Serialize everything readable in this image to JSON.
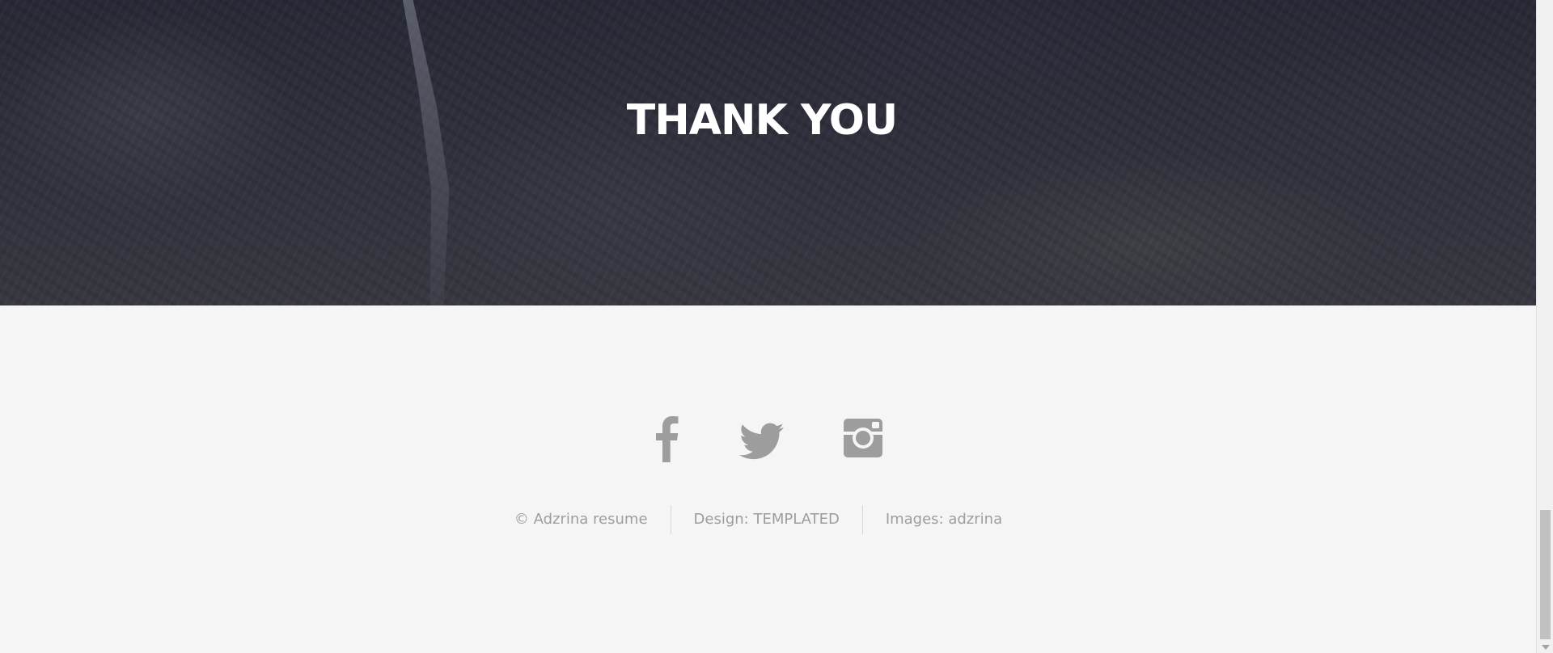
{
  "banner": {
    "title": "THANK YOU"
  },
  "footer": {
    "social": [
      {
        "name": "facebook",
        "icon": "facebook-icon"
      },
      {
        "name": "twitter",
        "icon": "twitter-icon"
      },
      {
        "name": "instagram",
        "icon": "instagram-icon"
      }
    ],
    "credits": {
      "copyright": "© Adzrina resume",
      "design": "Design: TEMPLATED",
      "images": "Images: adzrina"
    }
  },
  "colors": {
    "footer_background": "#f5f5f5",
    "icon_color": "#9d9d9d",
    "credit_text": "#9d9d9d",
    "banner_title": "#ffffff"
  }
}
